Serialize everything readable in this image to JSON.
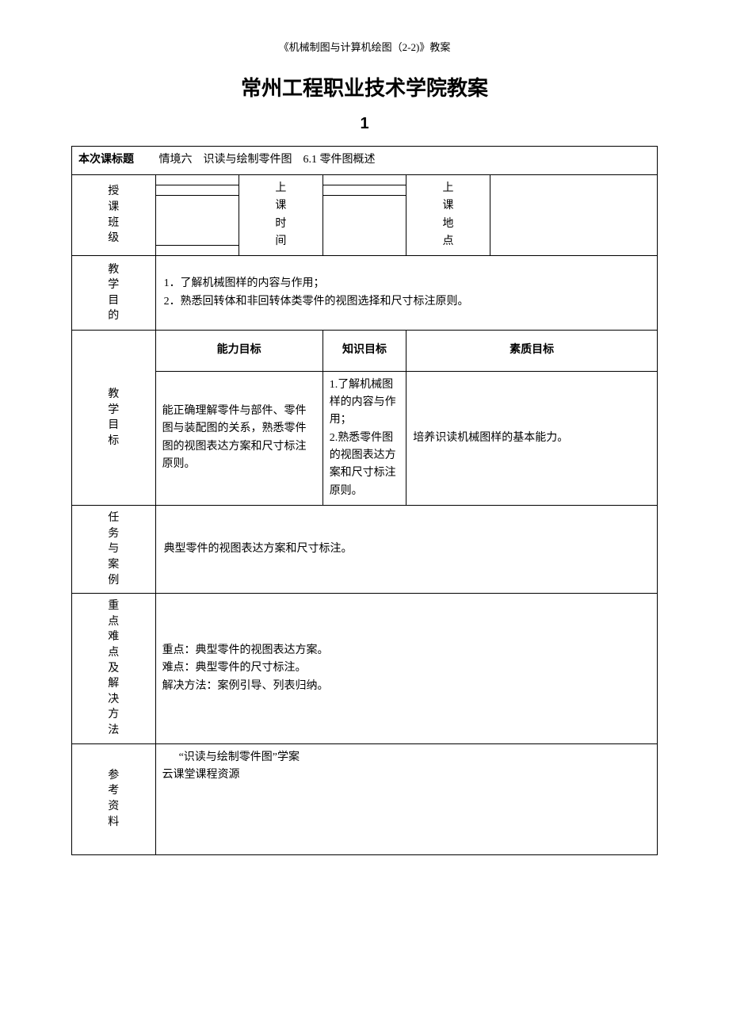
{
  "header": "《机械制图与计算机绘图（2-2)》教案",
  "title": "常州工程职业技术学院教案",
  "subtitle": "1",
  "topic": {
    "label": "本次课标题",
    "value": "情境六　识读与绘制零件图　6.1 零件图概述"
  },
  "row1": {
    "teach_class_label_c1": "授",
    "teach_class_label_c2": "课",
    "teach_class_label_c3": "班",
    "teach_class_label_c4": "级",
    "class_time_label_c1": "上",
    "class_time_label_c2": "课",
    "class_time_label_c3": "时",
    "class_time_label_c4": "间",
    "class_place_label_c1": "上",
    "class_place_label_c2": "课",
    "class_place_label_c3": "地",
    "class_place_label_c4": "点"
  },
  "purpose": {
    "label_c1": "教",
    "label_c2": "学",
    "label_c3": "目",
    "label_c4": "的",
    "line1": "1．了解机械图样的内容与作用；",
    "line2": "2．熟悉回转体和非回转体类零件的视图选择和尺寸标注原则。"
  },
  "goals": {
    "label_c1": "教",
    "label_c2": "学",
    "label_c3": "目",
    "label_c4": "标",
    "header1": "能力目标",
    "header2": "知识目标",
    "header3": "素质目标",
    "ability": "能正确理解零件与部件、零件图与装配图的关系，熟悉零件图的视图表达方案和尺寸标注原则。",
    "knowledge_l1": "1.了解机械图样的内容与作用；",
    "knowledge_l2": "2.熟悉零件图的视图表达方案和尺寸标注原则。",
    "quality": "培养识读机械图样的基本能力。"
  },
  "task": {
    "label_c1": "任",
    "label_c2": "务",
    "label_c3": "与",
    "label_c4": "案",
    "label_c5": "例",
    "content": "典型零件的视图表达方案和尺寸标注。"
  },
  "keypoints": {
    "label_c1": "重",
    "label_c2": "点",
    "label_c3": "难",
    "label_c4": "点",
    "label_c5": "及",
    "label_c6": "解",
    "label_c7": "决",
    "label_c8": "方",
    "label_c9": "法",
    "line1": "重点：典型零件的视图表达方案。",
    "line2": "难点：典型零件的尺寸标注。",
    "line3": "解决方法：案例引导、列表归纳。"
  },
  "resources": {
    "label_c1": "参",
    "label_c2": "考",
    "label_c3": "资",
    "label_c4": "料",
    "line1": "“识读与绘制零件图”学案",
    "line2": "云课堂课程资源"
  }
}
